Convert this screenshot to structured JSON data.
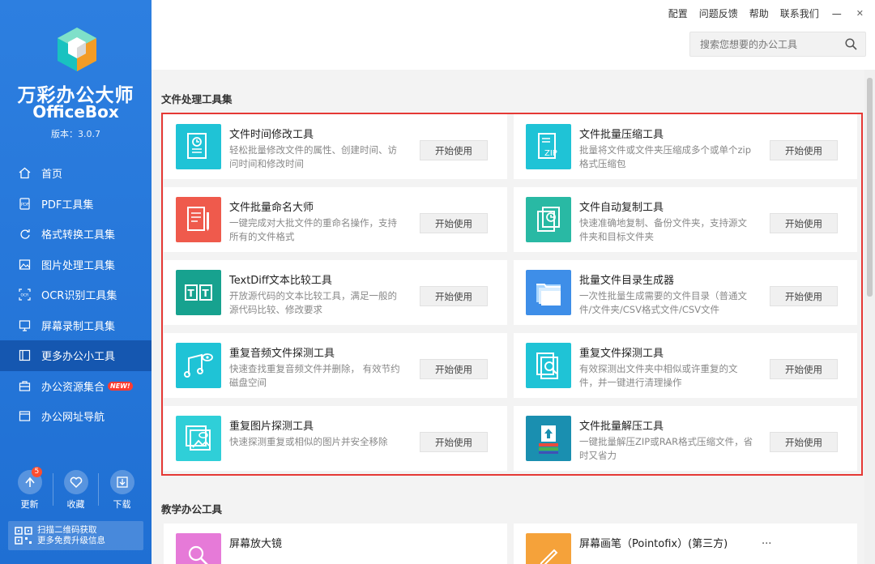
{
  "app": {
    "name_cn": "万彩办公大师",
    "name_en": "OfficeBox",
    "version": "版本：3.0.7"
  },
  "topbar": {
    "links": [
      "配置",
      "问题反馈",
      "帮助",
      "联系我们"
    ],
    "minimize": "—",
    "close": "✕",
    "search_placeholder": "搜索您想要的办公工具"
  },
  "sidebar": {
    "items": [
      {
        "label": "首页",
        "icon": "home-icon"
      },
      {
        "label": "PDF工具集",
        "icon": "pdf-icon"
      },
      {
        "label": "格式转换工具集",
        "icon": "convert-icon"
      },
      {
        "label": "图片处理工具集",
        "icon": "image-icon"
      },
      {
        "label": "OCR识别工具集",
        "icon": "ocr-icon"
      },
      {
        "label": "屏幕录制工具集",
        "icon": "screen-record-icon"
      },
      {
        "label": "更多办公小工具",
        "icon": "tools-icon",
        "active": true
      },
      {
        "label": "办公资源集合",
        "icon": "briefcase-icon",
        "badge": "NEW!"
      },
      {
        "label": "办公网址导航",
        "icon": "browser-icon"
      }
    ],
    "actions": [
      {
        "label": "更新",
        "icon": "update-icon",
        "count": "5"
      },
      {
        "label": "收藏",
        "icon": "heart-icon"
      },
      {
        "label": "下载",
        "icon": "download-icon"
      }
    ],
    "qr_line1": "扫描二维码获取",
    "qr_line2": "更多免费升级信息"
  },
  "sections": {
    "file_tools_title": "文件处理工具集",
    "teaching_tools_title": "教学办公工具",
    "start_label": "开始使用"
  },
  "file_tools": [
    {
      "title": "文件时间修改工具",
      "desc": "轻松批量修改文件的属性、创建时间、访问时间和修改时间",
      "color": "#1fc3d6",
      "icon": "file-time-icon"
    },
    {
      "title": "文件批量压缩工具",
      "desc": "批量将文件或文件夹压缩成多个或单个zip格式压缩包",
      "color": "#1fc3d6",
      "icon": "zip-icon"
    },
    {
      "title": "文件批量命名大师",
      "desc": "一键完成对大批文件的重命名操作，支持所有的文件格式",
      "color": "#ef5a4c",
      "icon": "rename-icon"
    },
    {
      "title": "文件自动复制工具",
      "desc": "快速准确地复制、备份文件夹，支持源文件夹和目标文件夹",
      "color": "#29b9a4",
      "icon": "copy-clock-icon"
    },
    {
      "title": "TextDiff文本比较工具",
      "desc": "开放源代码的文本比较工具，满足一般的源代码比较、修改要求",
      "color": "#17a28f",
      "icon": "text-diff-icon"
    },
    {
      "title": "批量文件目录生成器",
      "desc": "一次性批量生成需要的文件目录（普通文件/文件夹/CSV格式文件/CSV文件",
      "color": "#3e8ee8",
      "icon": "folder-list-icon"
    },
    {
      "title": "重复音频文件探测工具",
      "desc": "快速查找重复音频文件并删除， 有效节约磁盘空间",
      "color": "#1fc3d6",
      "icon": "music-search-icon"
    },
    {
      "title": "重复文件探测工具",
      "desc": "有效探测出文件夹中相似或许重复的文件，并一键进行清理操作",
      "color": "#1fc3d6",
      "icon": "file-search-icon"
    },
    {
      "title": "重复图片探测工具",
      "desc": "快速探测重复或相似的图片并安全移除",
      "color": "#2fcfd8",
      "icon": "image-search-icon"
    },
    {
      "title": "文件批量解压工具",
      "desc": "一键批量解压ZIP或RAR格式压缩文件，省时又省力",
      "color": "#1a8fb0",
      "icon": "unzip-icon"
    }
  ],
  "teaching_tools": [
    {
      "title": "屏幕放大镜",
      "color": "#e67ad8",
      "icon": "magnifier-icon"
    },
    {
      "title": "屏幕画笔（Pointofix）(第三方)",
      "color": "#f5a23a",
      "icon": "pen-icon",
      "more": "..."
    }
  ]
}
